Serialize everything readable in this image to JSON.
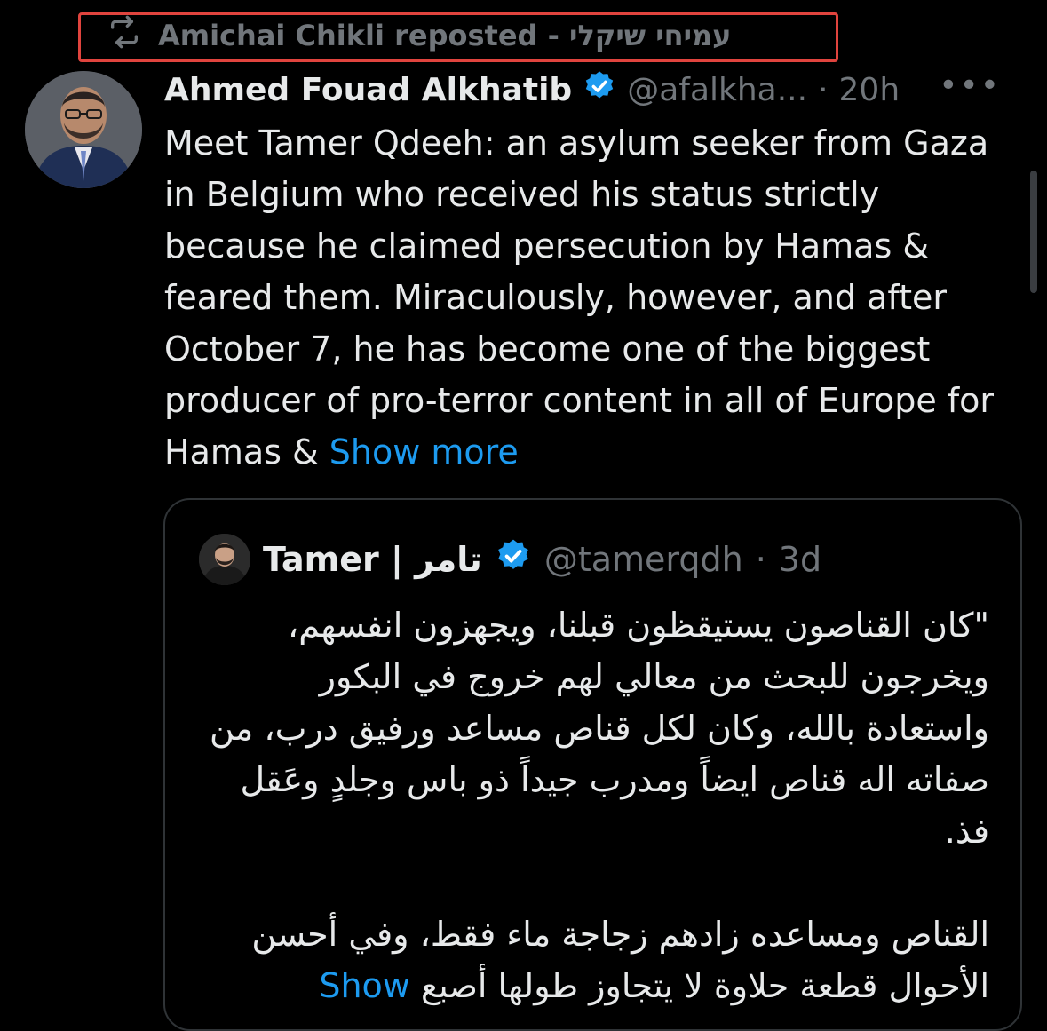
{
  "repost": {
    "text": "Amichai Chikli reposted - עמיחי שיקלי",
    "icon": "repost-icon"
  },
  "tweet": {
    "author_name": "Ahmed Fouad Alkhatib",
    "handle": "@afalkha...",
    "separator": "·",
    "time": "20h",
    "more": "•••",
    "body": "Meet Tamer Qdeeh: an asylum seeker from Gaza in Belgium who received his status strictly because he claimed persecution by Hamas & feared them. Miraculously, however, and after October 7, he has become one of the biggest producer of pro-terror content in all of Europe for Hamas & ",
    "show_more": "Show more"
  },
  "quote": {
    "author_name": "Tamer | تامر",
    "handle": "@tamerqdh",
    "separator": "·",
    "time": "3d",
    "paragraph1": "\"كان القناصون يستيقظون قبلنا، ويجهزون انفسهم، ويخرجون للبحث من معالي لهم خروج في البكور واستعادة بالله، وكان لكل قناص مساعد ورفيق درب، من صفاته اله قناص ايضاً ومدرب جيداً ذو باس وجلدٍ وعَقل فذ.",
    "paragraph2": "القناص ومساعده زادهم زجاجة ماء فقط، وفي أحسن الأحوال قطعة حلاوة لا يتجاوز طولها أصبع ",
    "show_more": "Show"
  },
  "colors": {
    "background": "#000000",
    "text": "#e7e9ea",
    "muted": "#71767b",
    "link": "#1d9bf0",
    "verified": "#1d9bf0",
    "highlight_box": "#e0443e",
    "card_border": "#2f3336"
  }
}
